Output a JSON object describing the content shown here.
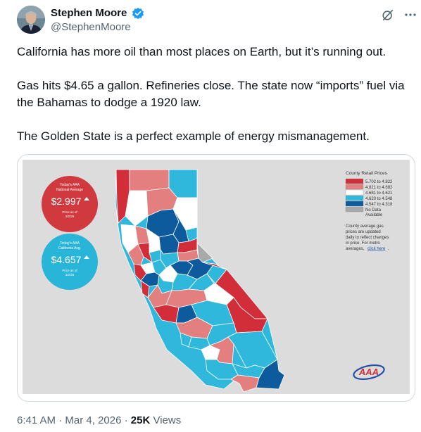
{
  "author": {
    "name": "Stephen Moore",
    "handle": "@StephenMoore",
    "verified": true,
    "verified_color": "#1d9bf0"
  },
  "icons": [
    "verified-badge-icon",
    "grok-icon",
    "more-icon"
  ],
  "tweet": {
    "paragraphs": [
      "California has more oil than most places on Earth, but it’s running out.",
      "Gas hits $4.65 a gallon. Refineries close. The state now “imports” fuel via the Bahamas to dodge a 1920 law.",
      "The Golden State is a perfect example of energy mismanagement."
    ]
  },
  "media": {
    "national_badge": {
      "label1": "Today's AAA",
      "label2": "National Average",
      "price": "$2.997",
      "asof1": "Price as of",
      "asof2": "3/2/26",
      "color": "#d03a3f",
      "trend": "up"
    },
    "california_badge": {
      "label1": "Today's AAA",
      "label2": "California Avg.",
      "price": "$4.657",
      "asof1": "Price as of",
      "asof2": "3/2/26",
      "color": "#29b5d8",
      "trend": "up"
    },
    "legend": {
      "title": "County Retail Prices",
      "items": [
        {
          "label": "5.702 to 4.822",
          "color": "#d12e3a"
        },
        {
          "label": "4.821 to 4.682",
          "color": "#e37f7e"
        },
        {
          "label": "4.681 to 4.621",
          "color": "#ffffff"
        },
        {
          "label": "4.620 to 4.548",
          "color": "#2fb8dc"
        },
        {
          "label": "4.547 to 4.318",
          "color": "#0d5a9c"
        },
        {
          "label": "No Data",
          "color": "#a9a9a9"
        },
        {
          "label": "Available",
          "color": ""
        }
      ],
      "note_lines": [
        "County average gas",
        "prices are updated",
        "daily to reflect changes",
        "in price. For metro",
        "averages,"
      ],
      "link": "click here",
      "link_suffix": "."
    },
    "logo_text": "AAA"
  },
  "footer": {
    "time": "6:41 AM",
    "date": "Mar 4, 2026",
    "views_count": "25K",
    "views_label": "Views"
  }
}
